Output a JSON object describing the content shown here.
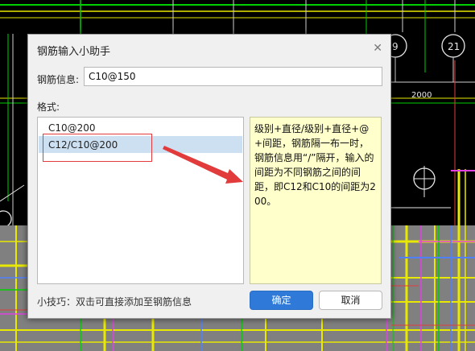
{
  "cad": {
    "bubble_labels": [
      "9",
      "21"
    ],
    "dimension_label": "2000"
  },
  "dialog": {
    "title": "钢筋输入小助手",
    "close_glyph": "✕",
    "info_label": "钢筋信息:",
    "info_value": "C10@150",
    "format_label": "格式:",
    "formats": [
      "C10@200",
      "C12/C10@200"
    ],
    "selected_index": 1,
    "description": "级别+直径/级别+直径+@+间距，钢筋隔一布一时，钢筋信息用“/”隔开，输入的间距为不同钢筋之间的间距，即C12和C10的间距为200。",
    "tip": "小技巧：双击可直接添加至钢筋信息",
    "ok_label": "确定",
    "cancel_label": "取消"
  },
  "colors": {
    "dialog_bg": "#f0f0f0",
    "selection": "#cde0f2",
    "description_bg": "#ffffcc",
    "ok_button": "#2f7ad9",
    "annotation_red": "#e13b3b",
    "cad_green": "#00d000",
    "cad_yellow": "#e8e800",
    "cad_magenta": "#e040e0"
  }
}
